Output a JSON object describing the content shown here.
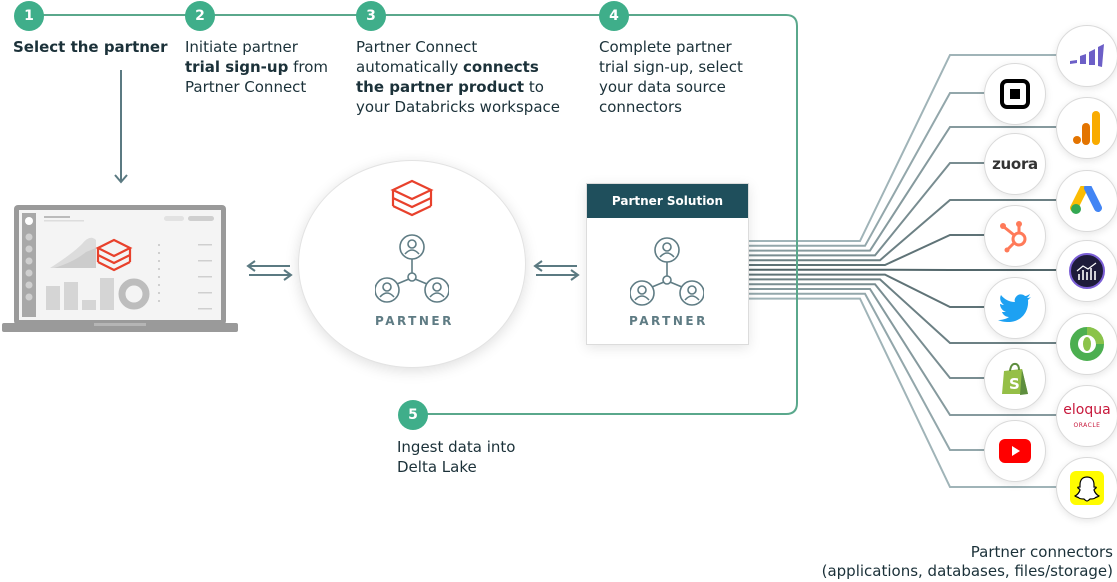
{
  "colors": {
    "step_accent": "#3fae8a",
    "flow_line": "#5aa88c",
    "arrow": "#5b7a82",
    "databricks_red": "#e8412c",
    "partner_header": "#1f4f5c",
    "partner_icon": "#5f7c84"
  },
  "steps": [
    {
      "number": "1",
      "text_parts": [
        {
          "t": "Select the partner",
          "bold": true
        }
      ]
    },
    {
      "number": "2",
      "text_parts": [
        {
          "t": "Initiate partner",
          "bold": false
        },
        {
          "t": "trial sign-up",
          "bold": true
        },
        {
          "t": " from",
          "bold": false
        },
        {
          "t": "Partner Connect",
          "bold": false
        }
      ]
    },
    {
      "number": "3",
      "text_parts": [
        {
          "t": "Partner Connect",
          "bold": false
        },
        {
          "t": "automatically ",
          "bold": false
        },
        {
          "t": "connects",
          "bold": true
        },
        {
          "t": "the partner product",
          "bold": true
        },
        {
          "t": " to",
          "bold": false
        },
        {
          "t": "your Databricks workspace",
          "bold": false
        }
      ]
    },
    {
      "number": "4",
      "text_parts": [
        {
          "t": "Complete partner",
          "bold": false
        },
        {
          "t": "trial sign-up, select",
          "bold": false
        },
        {
          "t": "your data source",
          "bold": false
        },
        {
          "t": "connectors",
          "bold": false
        }
      ]
    },
    {
      "number": "5",
      "text_parts": [
        {
          "t": "Ingest data into",
          "bold": false
        },
        {
          "t": "Delta Lake",
          "bold": false
        }
      ]
    }
  ],
  "step_labels": {
    "s1": "1",
    "s2": "2",
    "s3": "3",
    "s4": "4",
    "s5": "5"
  },
  "step_text": {
    "s1_bold": "Select the partner",
    "s2_line1": "Initiate partner",
    "s2_line2_bold": "trial sign-up",
    "s2_line2_rest": " from",
    "s2_line3": "Partner Connect",
    "s3_line1": "Partner Connect",
    "s3_line2_plain": "automatically ",
    "s3_line2_bold": "connects",
    "s3_line3_bold": "the partner product",
    "s3_line3_rest": " to",
    "s3_line4": "your Databricks workspace",
    "s4_line1": "Complete partner",
    "s4_line2": "trial sign-up, select",
    "s4_line3": "your data source",
    "s4_line4": "connectors",
    "s5_line1": "Ingest data into",
    "s5_line2": "Delta Lake"
  },
  "partner_circle": {
    "label": "PARTNER"
  },
  "partner_card": {
    "header": "Partner Solution",
    "label": "PARTNER"
  },
  "connectors": [
    {
      "name": "marketo",
      "icon": "marketo-logo-icon",
      "column": "right"
    },
    {
      "name": "square",
      "icon": "square-logo-icon",
      "column": "left"
    },
    {
      "name": "google-analytics",
      "icon": "google-analytics-logo-icon",
      "column": "right"
    },
    {
      "name": "zuora",
      "icon": "zuora-logo-icon",
      "column": "left",
      "text": "zuora"
    },
    {
      "name": "google-ads",
      "icon": "google-ads-logo-icon",
      "column": "right"
    },
    {
      "name": "hubspot",
      "icon": "hubspot-logo-icon",
      "column": "left"
    },
    {
      "name": "adobe-analytics",
      "icon": "adobe-analytics-logo-icon",
      "column": "right"
    },
    {
      "name": "twitter",
      "icon": "twitter-logo-icon",
      "column": "left"
    },
    {
      "name": "doubleclick",
      "icon": "doubleclick-logo-icon",
      "column": "right"
    },
    {
      "name": "shopify",
      "icon": "shopify-logo-icon",
      "column": "left"
    },
    {
      "name": "eloqua",
      "icon": "eloqua-logo-icon",
      "column": "right",
      "text": "eloqua",
      "subtext": "ORACLE"
    },
    {
      "name": "youtube",
      "icon": "youtube-logo-icon",
      "column": "left"
    },
    {
      "name": "snapchat",
      "icon": "snapchat-logo-icon",
      "column": "right"
    }
  ],
  "caption": {
    "line1": "Partner connectors",
    "line2": "(applications, databases, files/storage)"
  }
}
